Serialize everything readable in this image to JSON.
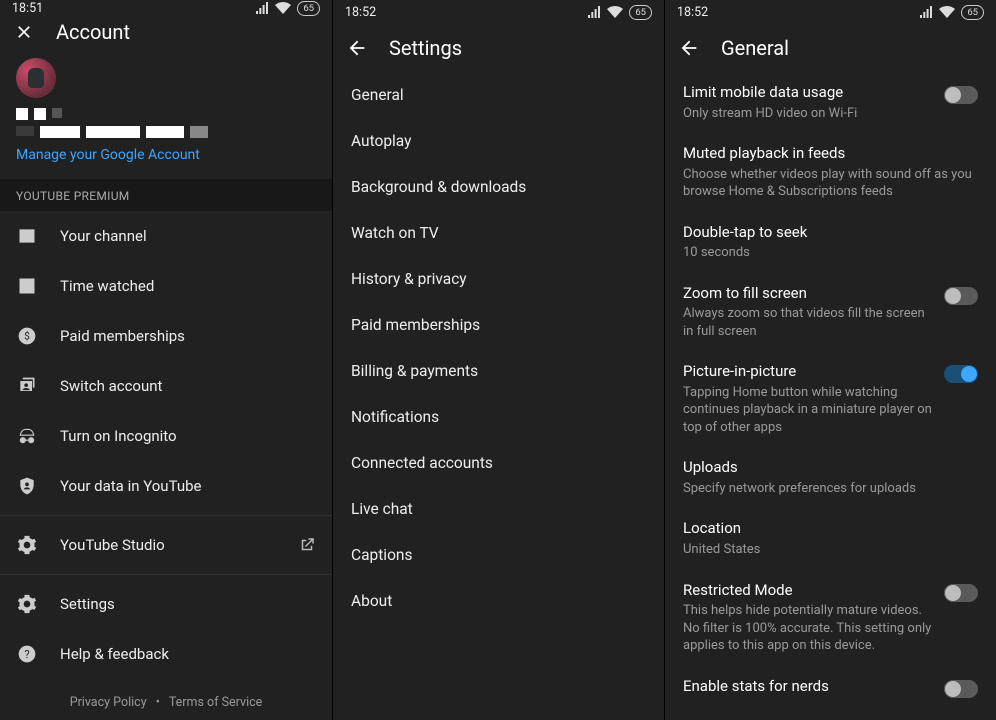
{
  "status": {
    "time1": "18:51",
    "time2": "18:52",
    "time3": "18:52",
    "battery": "65"
  },
  "account": {
    "title": "Account",
    "manage_link": "Manage your Google Account",
    "section_header": "YOUTUBE PREMIUM",
    "items": [
      {
        "label": "Your channel"
      },
      {
        "label": "Time watched"
      },
      {
        "label": "Paid memberships"
      },
      {
        "label": "Switch account"
      },
      {
        "label": "Turn on Incognito"
      },
      {
        "label": "Your data in YouTube"
      }
    ],
    "studio": "YouTube Studio",
    "settings": "Settings",
    "help": "Help & feedback",
    "footer": {
      "privacy": "Privacy Policy",
      "tos": "Terms of Service"
    }
  },
  "settings": {
    "title": "Settings",
    "items": [
      "General",
      "Autoplay",
      "Background & downloads",
      "Watch on TV",
      "History & privacy",
      "Paid memberships",
      "Billing & payments",
      "Notifications",
      "Connected accounts",
      "Live chat",
      "Captions",
      "About"
    ]
  },
  "general": {
    "title": "General",
    "items": [
      {
        "title": "Limit mobile data usage",
        "sub": "Only stream HD video on Wi-Fi",
        "toggle": "off"
      },
      {
        "title": "Muted playback in feeds",
        "sub": "Choose whether videos play with sound off as you browse Home & Subscriptions feeds"
      },
      {
        "title": "Double-tap to seek",
        "sub": "10 seconds"
      },
      {
        "title": "Zoom to fill screen",
        "sub": "Always zoom so that videos fill the screen in full screen",
        "toggle": "off"
      },
      {
        "title": "Picture-in-picture",
        "sub": "Tapping Home button while watching continues playback in a miniature player on top of other apps",
        "toggle": "on"
      },
      {
        "title": "Uploads",
        "sub": "Specify network preferences for uploads"
      },
      {
        "title": "Location",
        "sub": "United States"
      },
      {
        "title": "Restricted Mode",
        "sub": "This helps hide potentially mature videos. No filter is 100% accurate. This setting only applies to this app on this device.",
        "toggle": "off"
      },
      {
        "title": "Enable stats for nerds",
        "toggle": "off"
      }
    ]
  }
}
